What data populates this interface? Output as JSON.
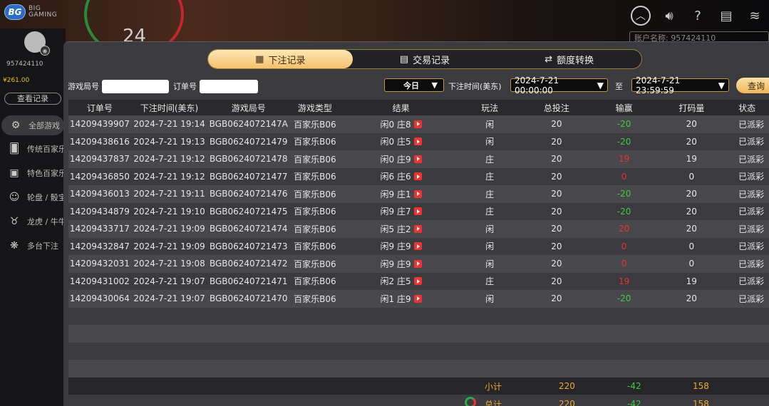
{
  "logo": {
    "badge": "BG",
    "line1": "BIG",
    "line2": "GAMING"
  },
  "wheel_number": "24",
  "account_label": "账户名称: 957424110",
  "top_icons": [
    "chevron-up-icon",
    "volume-icon",
    "help-icon",
    "rules-icon",
    "wifi-icon"
  ],
  "user": {
    "id": "957424110",
    "balance": "¥261.00",
    "history_button": "查看记录"
  },
  "sidebar": {
    "items": [
      {
        "label": "全部游戏",
        "icon": "all-games-icon"
      },
      {
        "label": "传统百家乐",
        "icon": "baccarat-icon"
      },
      {
        "label": "特色百家乐",
        "icon": "special-baccarat-icon"
      },
      {
        "label": "轮盘 / 骰宝",
        "icon": "roulette-icon"
      },
      {
        "label": "龙虎 / 牛牛",
        "icon": "dragon-tiger-icon"
      },
      {
        "label": "多台下注",
        "icon": "multi-table-icon"
      }
    ]
  },
  "tabs": [
    {
      "label": "下注记录",
      "icon": "calendar-icon"
    },
    {
      "label": "交易记录",
      "icon": "receipt-icon"
    },
    {
      "label": "额度转换",
      "icon": "transfer-icon"
    }
  ],
  "filter": {
    "game_no_label": "游戏局号",
    "order_no_label": "订单号",
    "date_select": "今日",
    "bet_time_label": "下注时间(美东)",
    "start": "2024-7-21 00:00:00",
    "to_label": "至",
    "end": "2024-7-21 23:59:59",
    "query_button": "查询"
  },
  "columns": [
    "订单号",
    "下注时间(美东)",
    "游戏局号",
    "游戏类型",
    "结果",
    "玩法",
    "总投注",
    "输赢",
    "打码量",
    "状态"
  ],
  "rows": [
    {
      "order": "14209439907",
      "time": "2024-7-21 19:14",
      "game_no": "BGB0624072147A",
      "type": "百家乐B06",
      "result": "闲0 庄8",
      "play": "闲",
      "bet": "20",
      "win": "-20",
      "code": "20",
      "status": "已派彩"
    },
    {
      "order": "14209438616",
      "time": "2024-7-21 19:13",
      "game_no": "BGB06240721479",
      "type": "百家乐B06",
      "result": "闲0 庄5",
      "play": "闲",
      "bet": "20",
      "win": "-20",
      "code": "20",
      "status": "已派彩"
    },
    {
      "order": "14209437837",
      "time": "2024-7-21 19:12",
      "game_no": "BGB06240721478",
      "type": "百家乐B06",
      "result": "闲0 庄9",
      "play": "庄",
      "bet": "20",
      "win": "19",
      "code": "19",
      "status": "已派彩"
    },
    {
      "order": "14209436850",
      "time": "2024-7-21 19:12",
      "game_no": "BGB06240721477",
      "type": "百家乐B06",
      "result": "闲6 庄6",
      "play": "庄",
      "bet": "20",
      "win": "0",
      "code": "0",
      "status": "已派彩"
    },
    {
      "order": "14209436013",
      "time": "2024-7-21 19:11",
      "game_no": "BGB06240721476",
      "type": "百家乐B06",
      "result": "闲9 庄1",
      "play": "庄",
      "bet": "20",
      "win": "-20",
      "code": "20",
      "status": "已派彩"
    },
    {
      "order": "14209434879",
      "time": "2024-7-21 19:10",
      "game_no": "BGB06240721475",
      "type": "百家乐B06",
      "result": "闲9 庄7",
      "play": "庄",
      "bet": "20",
      "win": "-20",
      "code": "20",
      "status": "已派彩"
    },
    {
      "order": "14209433717",
      "time": "2024-7-21 19:09",
      "game_no": "BGB06240721474",
      "type": "百家乐B06",
      "result": "闲5 庄2",
      "play": "闲",
      "bet": "20",
      "win": "20",
      "code": "20",
      "status": "已派彩"
    },
    {
      "order": "14209432847",
      "time": "2024-7-21 19:09",
      "game_no": "BGB06240721473",
      "type": "百家乐B06",
      "result": "闲9 庄9",
      "play": "闲",
      "bet": "20",
      "win": "0",
      "code": "0",
      "status": "已派彩"
    },
    {
      "order": "14209432031",
      "time": "2024-7-21 19:08",
      "game_no": "BGB06240721472",
      "type": "百家乐B06",
      "result": "闲9 庄9",
      "play": "闲",
      "bet": "20",
      "win": "0",
      "code": "0",
      "status": "已派彩"
    },
    {
      "order": "14209431002",
      "time": "2024-7-21 19:07",
      "game_no": "BGB06240721471",
      "type": "百家乐B06",
      "result": "闲2 庄5",
      "play": "庄",
      "bet": "20",
      "win": "19",
      "code": "19",
      "status": "已派彩"
    },
    {
      "order": "14209430064",
      "time": "2024-7-21 19:07",
      "game_no": "BGB06240721470",
      "type": "百家乐B06",
      "result": "闲1 庄9",
      "play": "闲",
      "bet": "20",
      "win": "-20",
      "code": "20",
      "status": "已派彩"
    }
  ],
  "subtotal": {
    "label": "小计",
    "bet": "220",
    "win": "-42",
    "code": "158"
  },
  "total": {
    "label": "总计",
    "bet": "220",
    "win": "-42",
    "code": "158"
  }
}
